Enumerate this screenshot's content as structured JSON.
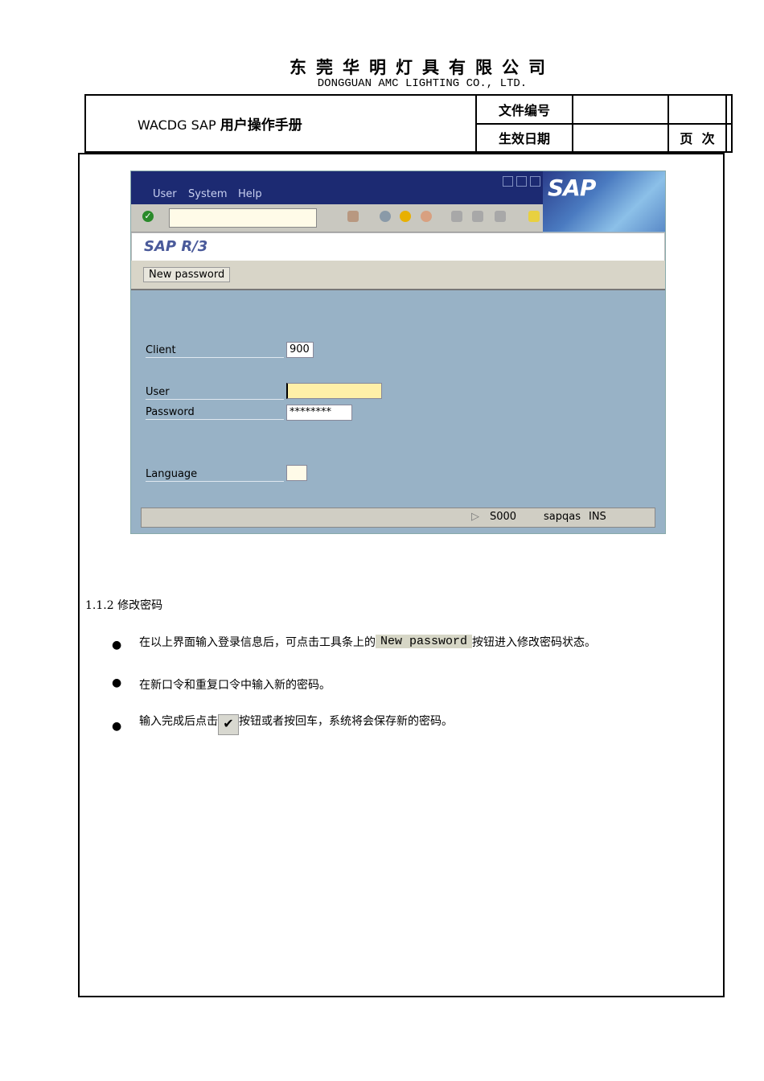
{
  "header": {
    "company_cn": "东莞华明灯具有限公司",
    "company_en": "DONGGUAN AMC LIGHTING CO., LTD.",
    "doc_title_prefix": "WACDG SAP",
    "doc_title_cn": "用户操作手册",
    "doc_no_label": "文件编号",
    "doc_no_value": "",
    "effective_date_label": "生效日期",
    "effective_date_value": "",
    "page_label": "页  次",
    "page_value": ""
  },
  "sap": {
    "menu": [
      "User",
      "System",
      "Help"
    ],
    "logo": "SAP",
    "screen_title": "SAP R/3",
    "new_password_button": "New password",
    "fields": {
      "client_label": "Client",
      "client_value": "900",
      "user_label": "User",
      "user_value": "",
      "password_label": "Password",
      "password_value": "********",
      "language_label": "Language",
      "language_value": ""
    },
    "status": {
      "session": "S000",
      "server": "sapqas",
      "mode": "INS"
    }
  },
  "content": {
    "section": "1.1.2 修改密码",
    "bullet1_pre": "在以上界面输入登录信息后，可点击工具条上的",
    "bullet1_btn": "New password",
    "bullet1_post": "按钮进入修改密码状态。",
    "bullet2": "在新口令和重复口令中输入新的密码。",
    "bullet3_pre": "输入完成后点击",
    "bullet3_post": "按钮或者按回车，系统将会保存新的密码。"
  }
}
